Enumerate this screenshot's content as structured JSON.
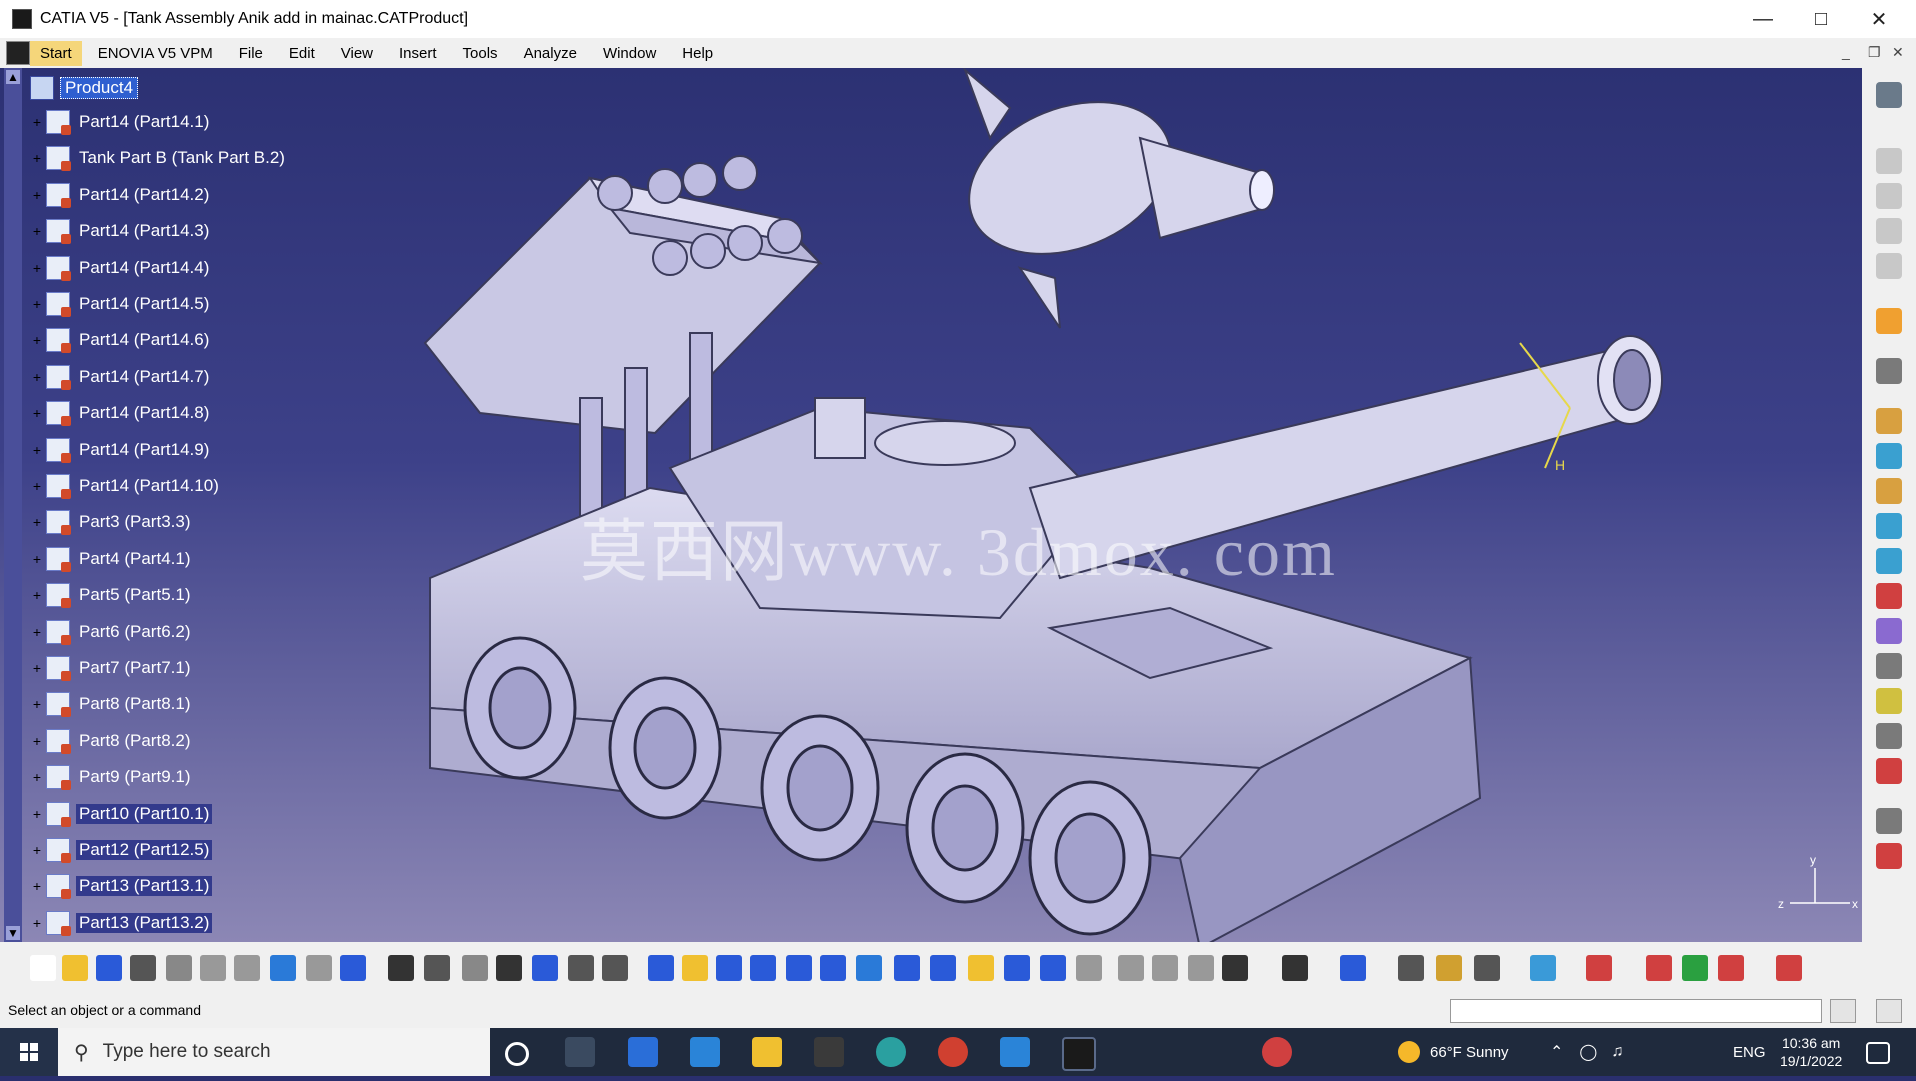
{
  "titlebar": {
    "title": "CATIA V5 - [Tank Assembly Anik add in mainac.CATProduct]",
    "minimize_icon": "minimize-icon",
    "maximize_icon": "maximize-icon",
    "close_icon": "close-icon"
  },
  "menubar": {
    "items": [
      "Start",
      "ENOVIA V5 VPM",
      "File",
      "Edit",
      "View",
      "Insert",
      "Tools",
      "Analyze",
      "Window",
      "Help"
    ]
  },
  "tree": {
    "root": "Product4",
    "items": [
      {
        "label": "Part14 (Part14.1)",
        "selected": false
      },
      {
        "label": "Tank Part B (Tank Part B.2)",
        "selected": false
      },
      {
        "label": "Part14 (Part14.2)",
        "selected": false
      },
      {
        "label": "Part14 (Part14.3)",
        "selected": false
      },
      {
        "label": "Part14 (Part14.4)",
        "selected": false
      },
      {
        "label": "Part14 (Part14.5)",
        "selected": false
      },
      {
        "label": "Part14 (Part14.6)",
        "selected": false
      },
      {
        "label": "Part14 (Part14.7)",
        "selected": false
      },
      {
        "label": "Part14 (Part14.8)",
        "selected": false
      },
      {
        "label": "Part14 (Part14.9)",
        "selected": false
      },
      {
        "label": "Part14 (Part14.10)",
        "selected": false
      },
      {
        "label": "Part3 (Part3.3)",
        "selected": false
      },
      {
        "label": "Part4 (Part4.1)",
        "selected": false
      },
      {
        "label": "Part5 (Part5.1)",
        "selected": false
      },
      {
        "label": "Part6 (Part6.2)",
        "selected": false
      },
      {
        "label": "Part7 (Part7.1)",
        "selected": false
      },
      {
        "label": "Part8 (Part8.1)",
        "selected": false
      },
      {
        "label": "Part8 (Part8.2)",
        "selected": false
      },
      {
        "label": "Part9 (Part9.1)",
        "selected": false
      },
      {
        "label": "Part10 (Part10.1)",
        "selected": true
      },
      {
        "label": "Part12 (Part12.5)",
        "selected": true
      },
      {
        "label": "Part13 (Part13.1)",
        "selected": true
      },
      {
        "label": "Part13 (Part13.2)",
        "selected": true
      }
    ]
  },
  "viewport": {
    "watermark": "莫西网www. 3dmox. com",
    "compass_label": "H",
    "axis_labels": {
      "y": "y",
      "x": "x",
      "z": "z"
    }
  },
  "toolbar": {
    "icons": [
      "new-icon",
      "open-icon",
      "save-icon",
      "print-icon",
      "cut-icon",
      "copy-icon",
      "paste-icon",
      "undo-icon",
      "redo-icon",
      "whats-this-icon",
      "formula-icon",
      "knowledge-icon",
      "tool-icon",
      "table-icon",
      "catalog-icon",
      "pan-part-icon",
      "measure-icon",
      "fly-icon",
      "fit-all-icon",
      "pan-icon",
      "rotate-icon",
      "zoom-in-icon",
      "zoom-out-icon",
      "normal-view-icon",
      "multi-view-icon",
      "iso-view-icon",
      "shading-icon",
      "hide-show-icon",
      "swap-icon",
      "sketch-icon",
      "scene-icon",
      "group-icon",
      "explode-icon",
      "camera-icon",
      "insert-component-icon",
      "measure-between-icon",
      "clash-icon",
      "section-icon",
      "update-icon",
      "publish-icon",
      "apply-material-icon",
      "render-icon",
      "color-icon",
      "grid-icon",
      "catia-logo-icon"
    ]
  },
  "statusbar": {
    "message": "Select an object or a command"
  },
  "taskbar": {
    "search_placeholder": "Type here to search",
    "weather": "66°F  Sunny",
    "language": "ENG",
    "time": "10:36 am",
    "date": "19/1/2022"
  },
  "colors": {
    "viewport_top": "#2c3173",
    "viewport_bottom": "#8c87b5",
    "selection": "#2f5fd0",
    "model_body": "#c9c8e4"
  }
}
